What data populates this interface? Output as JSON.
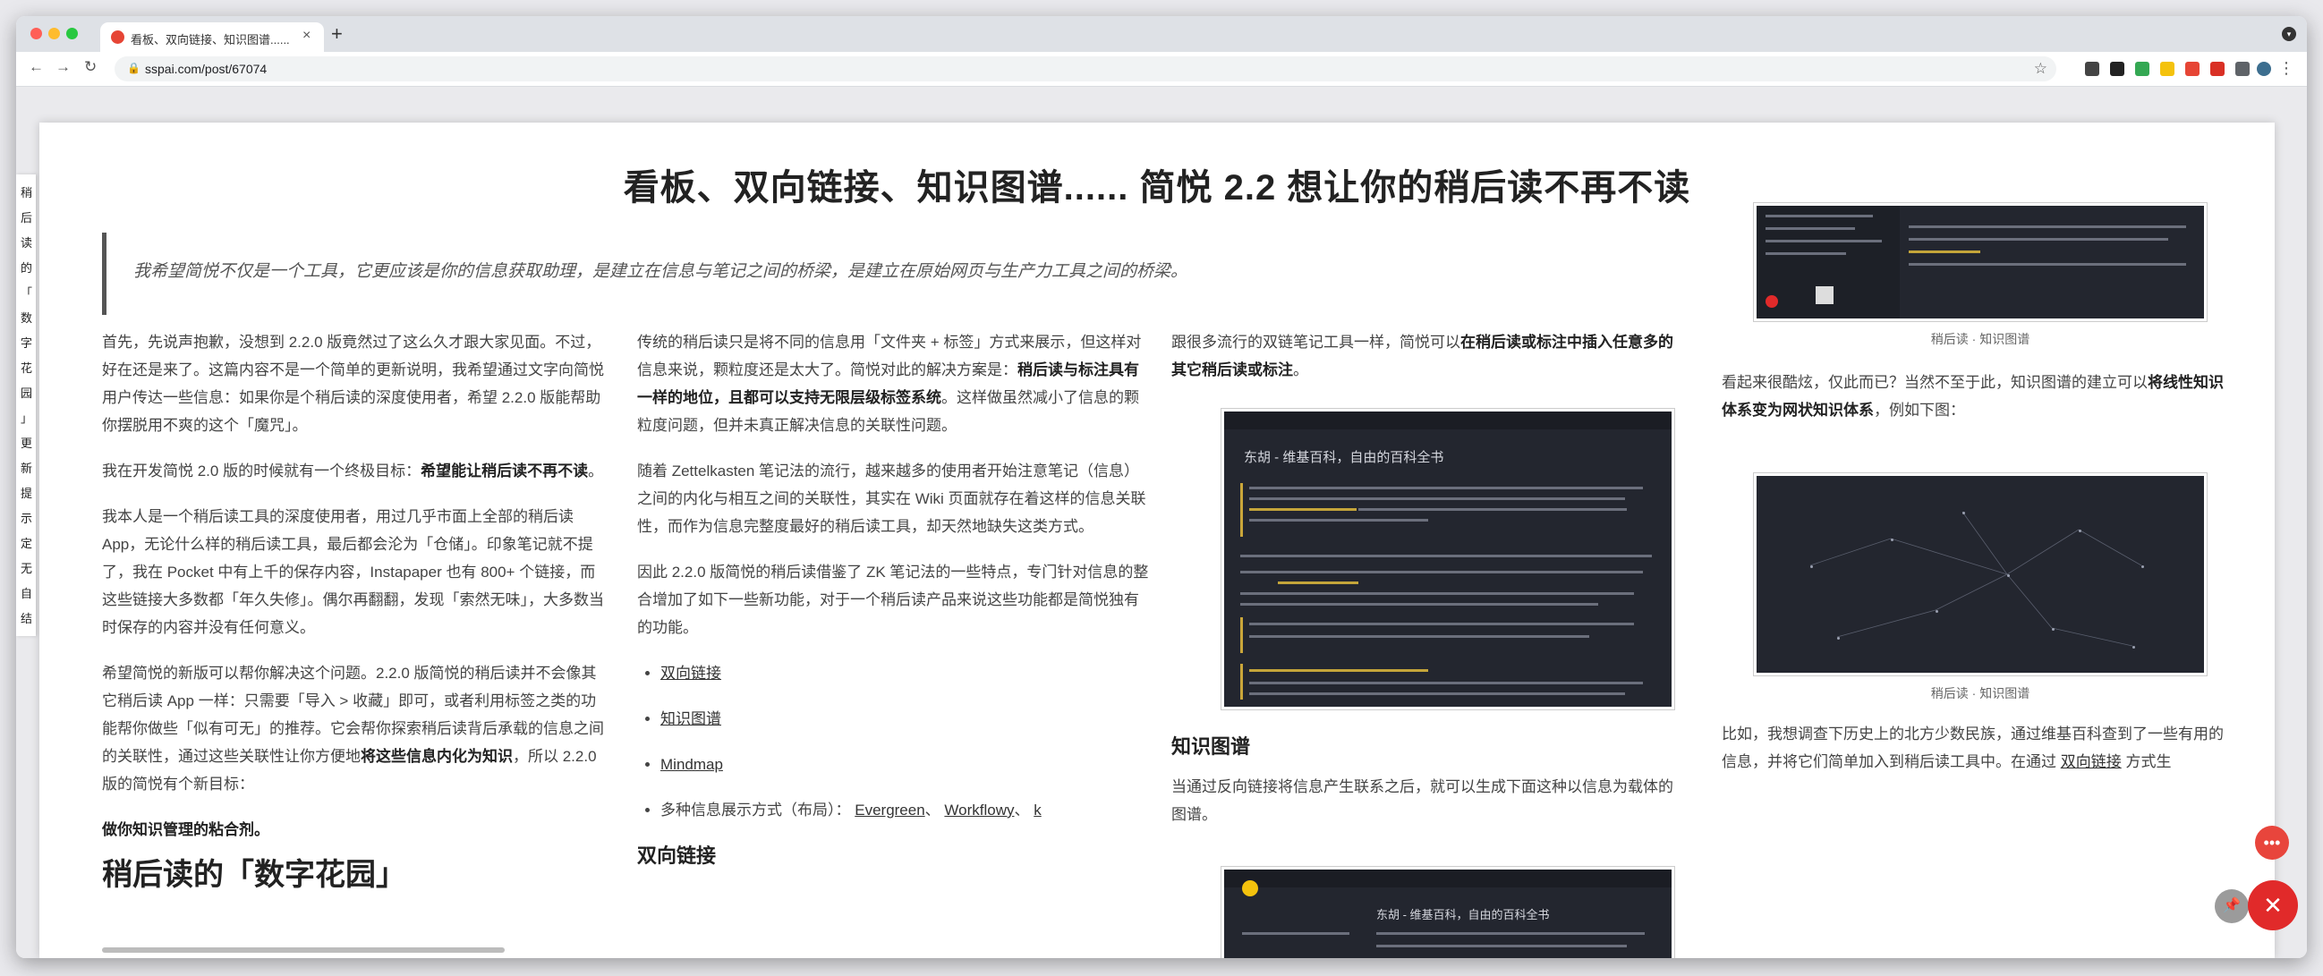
{
  "browser": {
    "tab_title": "看板、双向链接、知识图谱...... 简",
    "tab_close": "×",
    "new_tab": "+",
    "url": "sspai.com/post/67074",
    "back": "←",
    "forward": "→",
    "reload": "↻"
  },
  "toc": [
    "稍",
    "后",
    "读",
    "的",
    "「",
    "数",
    "字",
    "花",
    "园",
    "」",
    "更",
    "新",
    "提",
    "示",
    "定",
    "无",
    "自",
    "结"
  ],
  "article": {
    "title": "看板、双向链接、知识图谱...... 简悦 2.2 想让你的稍后读不再不读",
    "quote": "我希望简悦不仅是一个工具，它更应该是你的信息获取助理，是建立在信息与笔记之间的桥梁，是建立在原始网页与生产力工具之间的桥梁。",
    "col1": {
      "p1": "首先，先说声抱歉，没想到 2.2.0 版竟然过了这么久才跟大家见面。不过，好在还是来了。这篇内容不是一个简单的更新说明，我希望通过文字向简悦用户传达一些信息：如果你是个稍后读的深度使用者，希望 2.2.0 版能帮助你摆脱用不爽的这个「魔咒」。",
      "p2_a": "我在开发简悦 2.0 版的时候就有一个终极目标：",
      "p2_b": "希望能让稍后读不再不读",
      "p2_c": "。",
      "p3": "我本人是一个稍后读工具的深度使用者，用过几乎市面上全部的稍后读 App，无论什么样的稍后读工具，最后都会沦为「仓储」。印象笔记就不提了，我在 Pocket 中有上千的保存内容，Instapaper 也有 800+ 个链接，而这些链接大多数都「年久失修」。偶尔再翻翻，发现「索然无味」，大多数当时保存的内容并没有任何意义。",
      "p4_a": "希望简悦的新版可以帮你解决这个问题。2.2.0 版简悦的稍后读并不会像其它稍后读 App 一样：只需要「导入 > 收藏」即可，或者利用标签之类的功能帮你做些「似有可无」的推荐。它会帮你探索稍后读背后承载的信息之间的关联性，通过这些关联性让你方便地",
      "p4_b": "将这些信息内化为知识",
      "p4_c": "，所以 2.2.0 版的简悦有个新目标：",
      "p5": "做你知识管理的粘合剂。",
      "h2": "稍后读的「数字花园」"
    },
    "col2": {
      "p1_a": "传统的稍后读只是将不同的信息用「文件夹 + 标签」方式来展示，但这样对信息来说，颗粒度还是太大了。简悦对此的解决方案是：",
      "p1_b": "稍后读与标注具有一样的地位，且都可以支持无限层级标签系统",
      "p1_c": "。这样做虽然减小了信息的颗粒度问题，但并未真正解决信息的关联性问题。",
      "p2": "随着 Zettelkasten 笔记法的流行，越来越多的使用者开始注意笔记（信息）之间的内化与相互之间的关联性，其实在 Wiki 页面就存在着这样的信息关联性，而作为信息完整度最好的稍后读工具，却天然地缺失这类方式。",
      "p3": "因此 2.2.0 版简悦的稍后读借鉴了 ZK 笔记法的一些特点，专门针对信息的整合增加了如下一些新功能，对于一个稍后读产品来说这些功能都是简悦独有的功能。",
      "li1": "双向链接",
      "li2": "知识图谱",
      "li3": "Mindmap",
      "li4_a": "多种信息展示方式（布局）：",
      "li4_b": "Evergreen",
      "li4_c": "、",
      "li4_d": "Workflowy",
      "li4_e": "、",
      "li4_f": "k",
      "h3": "双向链接"
    },
    "col3": {
      "p1_a": "跟很多流行的双链笔记工具一样，简悦可以",
      "p1_b": "在稍后读或标注中插入任意多的其它稍后读或标注",
      "p1_c": "。",
      "shot_title": "东胡 - 维基百科，自由的百科全书",
      "h3": "知识图谱",
      "p2": "当通过反向链接将信息产生联系之后，就可以生成下面这种以信息为载体的图谱。",
      "shot2_title": "东胡 - 维基百科，自由的百科全书"
    },
    "col4": {
      "caption1": "稍后读 · 知识图谱",
      "p1_a": "看起来很酷炫，仅此而已？当然不至于此，知识图谱的建立可以",
      "p1_b": "将线性知识体系变为网状知识体系",
      "p1_c": "，例如下图：",
      "caption2": "稍后读 · 知识图谱",
      "p2_a": "比如，我想调查下历史上的北方少数民族，通过维基百科查到了一些有用的信息，并将它们简单加入到稍后读工具中。在通过 ",
      "p2_b": "双向链接",
      "p2_c": " 方式生"
    }
  },
  "fab": {
    "more": "•••",
    "close": "✕",
    "pin": "📌"
  },
  "colors": {
    "accent": "#e12a2a",
    "screenshot_bg": "#23262f",
    "highlight": "#c4a53a"
  }
}
